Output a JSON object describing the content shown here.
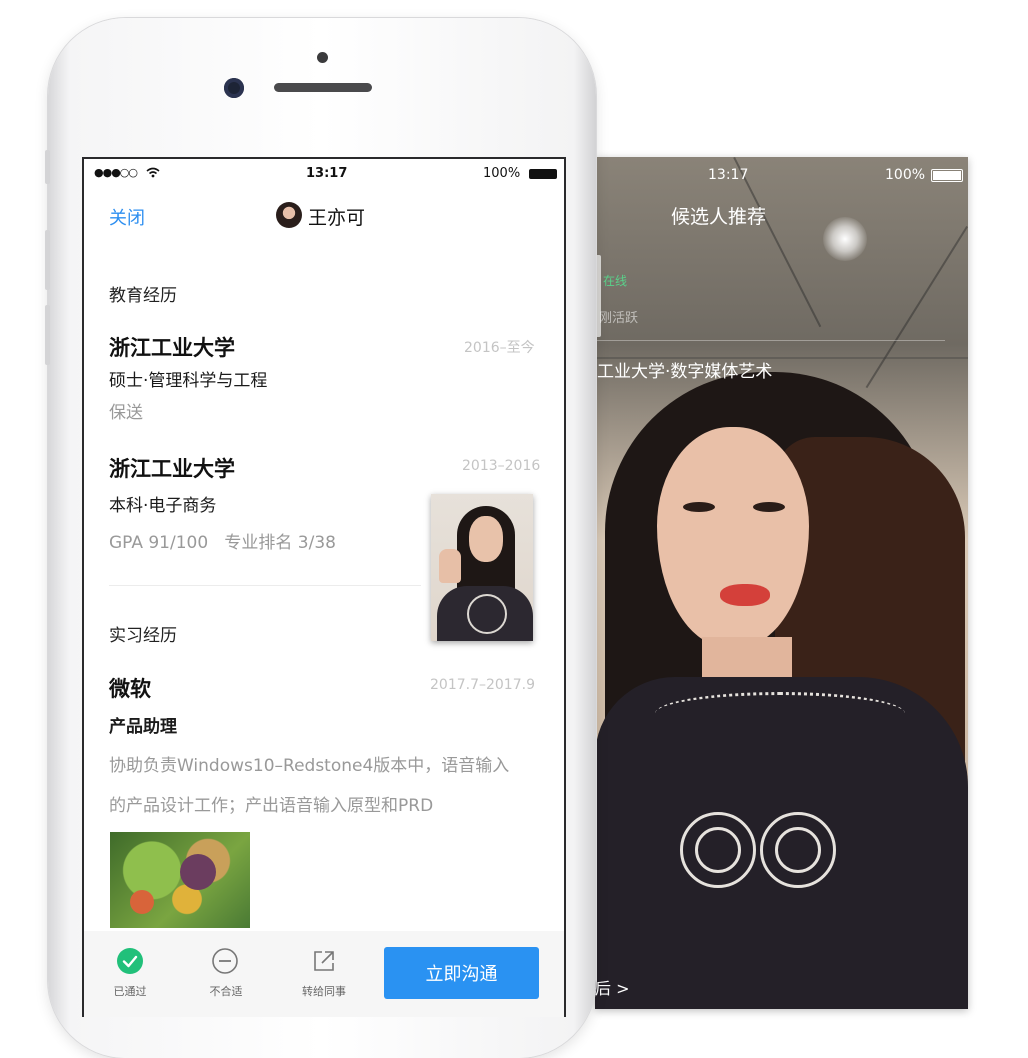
{
  "back_screen": {
    "status": {
      "time": "13:17",
      "battery": "100%"
    },
    "title": "候选人推荐",
    "tag_text": "在线",
    "activity_text": "刚活跃",
    "education_line": "工业大学·数字媒体艺术",
    "bottom_arrow": "后 >"
  },
  "front_screen": {
    "status": {
      "signal": "●●●○○",
      "time": "13:17",
      "battery": "100%"
    },
    "nav": {
      "close_label": "关闭",
      "candidate_name": "王亦可"
    },
    "education": {
      "heading": "教育经历",
      "entries": [
        {
          "school": "浙江工业大学",
          "date": "2016–至今",
          "degree": "硕士·管理科学与工程",
          "note": "保送"
        },
        {
          "school": "浙江工业大学",
          "date": "2013–2016",
          "degree": "本科·电子商务",
          "note": "GPA 91/100   专业排名 3/38"
        }
      ]
    },
    "internship": {
      "heading": "实习经历",
      "company": "微软",
      "date": "2017.7–2017.9",
      "role": "产品助理",
      "description_line1": "协助负责Windows10–Redstone4版本中，语音输入",
      "description_line2": "的产品设计工作；产出语音输入原型和PRD"
    },
    "actions": {
      "passed_label": "已通过",
      "reject_label": "不合适",
      "forward_label": "转给同事",
      "chat_label": "立即沟通"
    }
  },
  "colors": {
    "accent_blue": "#2a92f2",
    "passed_green": "#21c07a",
    "link_blue": "#2e8ff0"
  },
  "icons": [
    "wifi-icon",
    "battery-icon",
    "avatar",
    "check-circle-icon",
    "minus-circle-icon",
    "share-icon"
  ]
}
